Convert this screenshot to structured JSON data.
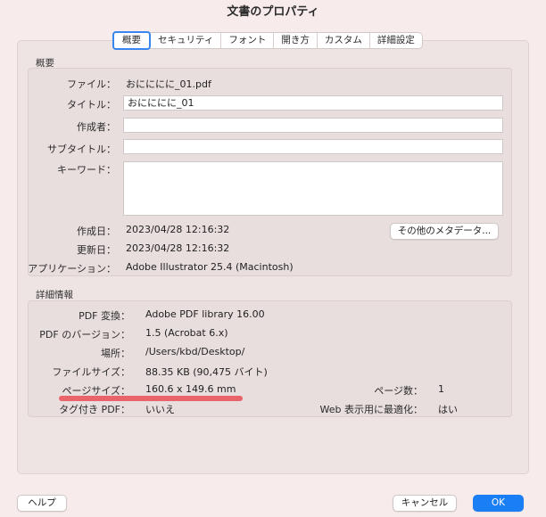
{
  "window": {
    "title": "文書のプロパティ"
  },
  "tabs": [
    {
      "label": "概要",
      "active": true
    },
    {
      "label": "セキュリティ"
    },
    {
      "label": "フォント"
    },
    {
      "label": "開き方"
    },
    {
      "label": "カスタム"
    },
    {
      "label": "詳細設定"
    }
  ],
  "summary": {
    "title": "概要",
    "file_label": "ファイル：",
    "file_value": "おにににに_01.pdf",
    "doc_title_label": "タイトル：",
    "doc_title_value": "おにににに_01",
    "author_label": "作成者：",
    "author_value": "",
    "subtitle_label": "サブタイトル：",
    "subtitle_value": "",
    "keywords_label": "キーワード：",
    "keywords_value": "",
    "created_label": "作成日：",
    "created_value": "2023/04/28 12:16:32",
    "modified_label": "更新日：",
    "modified_value": "2023/04/28 12:16:32",
    "application_label": "アプリケーション：",
    "application_value": "Adobe Illustrator 25.4 (Macintosh)",
    "more_metadata_button": "その他のメタデータ..."
  },
  "details": {
    "title": "詳細情報",
    "pdf_producer_label": "PDF 変換：",
    "pdf_producer_value": "Adobe PDF library 16.00",
    "pdf_version_label": "PDF のバージョン：",
    "pdf_version_value": "1.5 (Acrobat 6.x)",
    "location_label": "場所：",
    "location_value": "/Users/kbd/Desktop/",
    "file_size_label": "ファイルサイズ：",
    "file_size_value": "88.35 KB (90,475 バイト)",
    "page_size_label": "ページサイズ：",
    "page_size_value": "160.6 x 149.6 mm",
    "page_count_label": "ページ数：",
    "page_count_value": "1",
    "tagged_pdf_label": "タグ付き PDF：",
    "tagged_pdf_value": "いいえ",
    "fast_web_view_label": "Web 表示用に最適化：",
    "fast_web_view_value": "はい"
  },
  "footer": {
    "help_button": "ヘルプ",
    "cancel_button": "キャンセル",
    "ok_button": "OK"
  },
  "colors": {
    "accent": "#1a7ef5",
    "highlight_underline": "#e8646a",
    "window_background": "#f7ebeb"
  }
}
